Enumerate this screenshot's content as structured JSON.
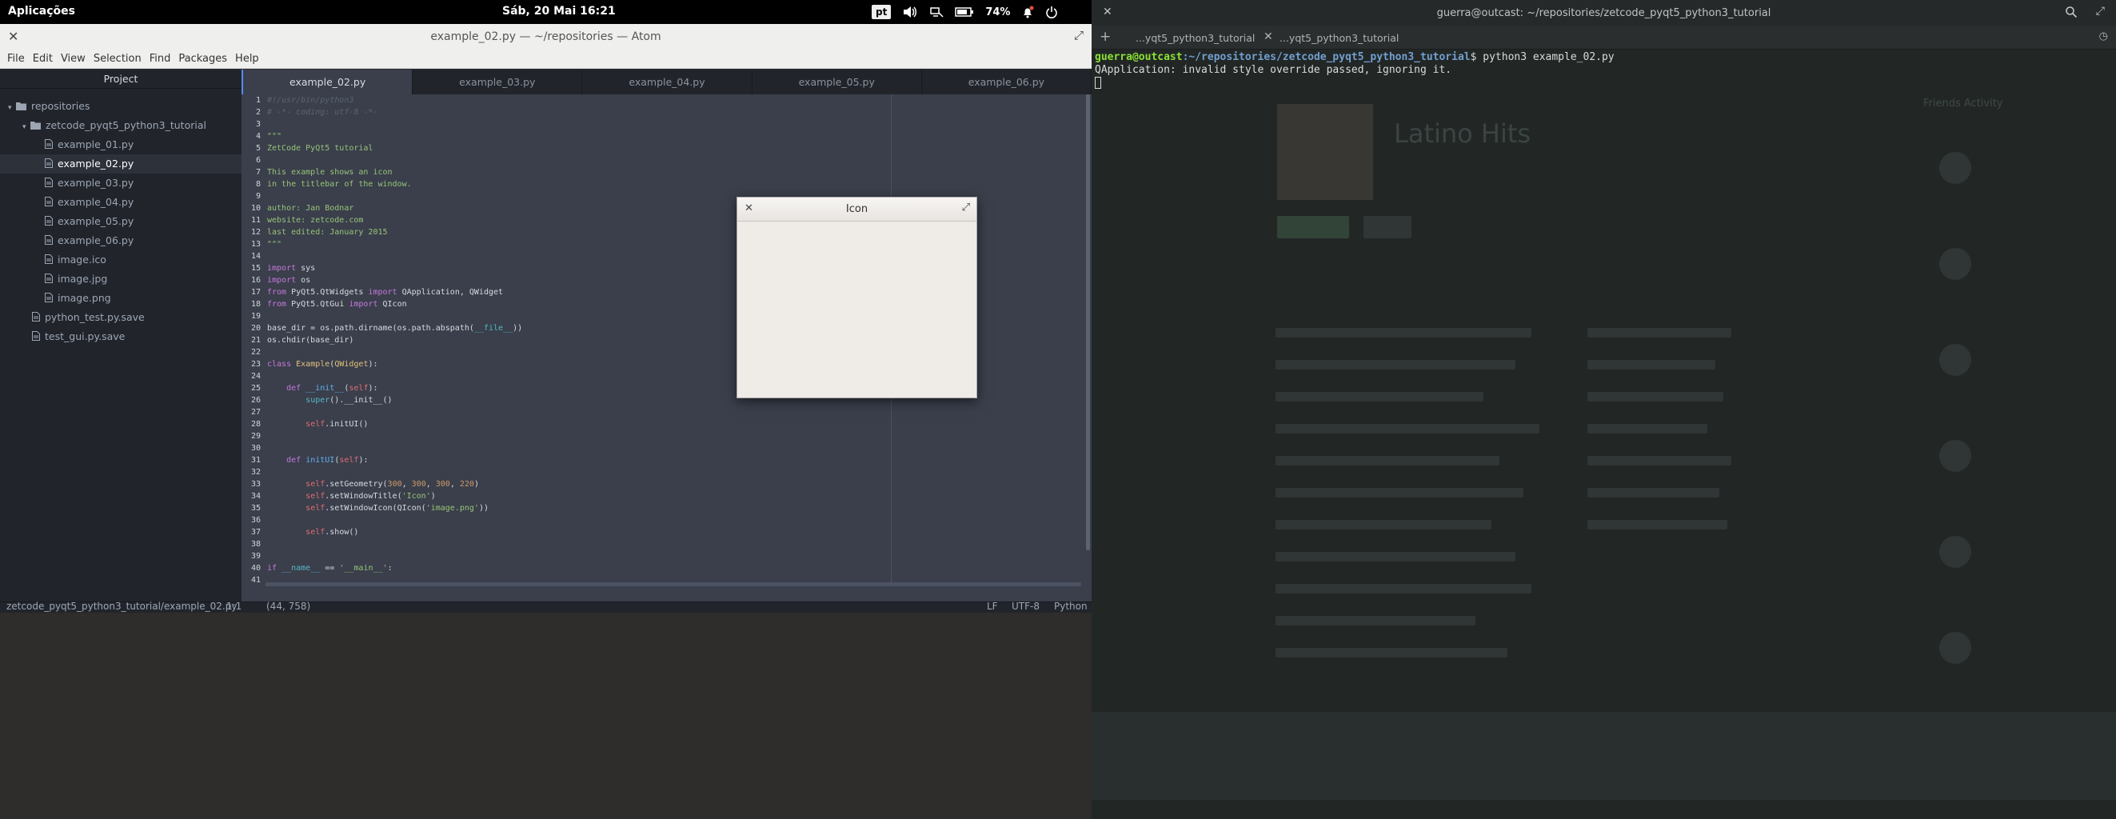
{
  "topbar": {
    "apps_label": "Aplicações",
    "clock": "Sáb, 20 Mai    16:21",
    "lang": "pt",
    "battery_pct": "74%"
  },
  "atom": {
    "title": "example_02.py — ~/repositories — Atom",
    "menu": [
      "File",
      "Edit",
      "View",
      "Selection",
      "Find",
      "Packages",
      "Help"
    ],
    "tree_header": "Project",
    "tree": [
      {
        "label": "repositories",
        "type": "folder",
        "depth": 0,
        "expanded": true,
        "selected": false
      },
      {
        "label": "zetcode_pyqt5_python3_tutorial",
        "type": "folder",
        "depth": 1,
        "expanded": true,
        "selected": false
      },
      {
        "label": "example_01.py",
        "type": "file",
        "depth": 2,
        "selected": false
      },
      {
        "label": "example_02.py",
        "type": "file",
        "depth": 2,
        "selected": true
      },
      {
        "label": "example_03.py",
        "type": "file",
        "depth": 2,
        "selected": false
      },
      {
        "label": "example_04.py",
        "type": "file",
        "depth": 2,
        "selected": false
      },
      {
        "label": "example_05.py",
        "type": "file",
        "depth": 2,
        "selected": false
      },
      {
        "label": "example_06.py",
        "type": "file",
        "depth": 2,
        "selected": false
      },
      {
        "label": "image.ico",
        "type": "file",
        "depth": 2,
        "selected": false
      },
      {
        "label": "image.jpg",
        "type": "file",
        "depth": 2,
        "selected": false
      },
      {
        "label": "image.png",
        "type": "file",
        "depth": 2,
        "selected": false
      },
      {
        "label": "python_test.py.save",
        "type": "file",
        "depth": 1,
        "selected": false
      },
      {
        "label": "test_gui.py.save",
        "type": "file",
        "depth": 1,
        "selected": false
      }
    ],
    "tabs": [
      {
        "label": "example_02.py",
        "active": true
      },
      {
        "label": "example_03.py",
        "active": false
      },
      {
        "label": "example_04.py",
        "active": false
      },
      {
        "label": "example_05.py",
        "active": false
      },
      {
        "label": "example_06.py",
        "active": false
      }
    ],
    "code_lines": [
      [
        [
          "cm",
          "#!/usr/bin/python3"
        ]
      ],
      [
        [
          "cm",
          "# -*- coding: utf-8 -*-"
        ]
      ],
      [],
      [
        [
          "str",
          "\"\"\""
        ]
      ],
      [
        [
          "str",
          "ZetCode PyQt5 tutorial"
        ]
      ],
      [],
      [
        [
          "str",
          "This example shows an icon"
        ]
      ],
      [
        [
          "str",
          "in the titlebar of the window."
        ]
      ],
      [],
      [
        [
          "str",
          "author: Jan Bodnar"
        ]
      ],
      [
        [
          "str",
          "website: zetcode.com"
        ]
      ],
      [
        [
          "str",
          "last edited: January 2015"
        ]
      ],
      [
        [
          "str",
          "\"\"\""
        ]
      ],
      [],
      [
        [
          "kw",
          "import"
        ],
        [
          "id",
          " sys"
        ]
      ],
      [
        [
          "kw",
          "import"
        ],
        [
          "id",
          " os"
        ]
      ],
      [
        [
          "kw",
          "from"
        ],
        [
          "id",
          " PyQt5.QtWidgets "
        ],
        [
          "kw",
          "import"
        ],
        [
          "id",
          " QApplication, QWidget"
        ]
      ],
      [
        [
          "kw",
          "from"
        ],
        [
          "id",
          " PyQt5.QtGui "
        ],
        [
          "kw",
          "import"
        ],
        [
          "id",
          " QIcon"
        ]
      ],
      [],
      [
        [
          "id",
          "base_dir = os.path.dirname(os.path.abspath("
        ],
        [
          "mag",
          "__file__"
        ],
        [
          "id",
          "))"
        ]
      ],
      [
        [
          "id",
          "os.chdir(base_dir)"
        ]
      ],
      [],
      [
        [
          "kw",
          "class"
        ],
        [
          "id",
          " "
        ],
        [
          "cls",
          "Example"
        ],
        [
          "id",
          "("
        ],
        [
          "cls",
          "QWidget"
        ],
        [
          "id",
          "):"
        ]
      ],
      [],
      [
        [
          "id",
          "    "
        ],
        [
          "kw",
          "def"
        ],
        [
          "id",
          " "
        ],
        [
          "fn",
          "__init__"
        ],
        [
          "id",
          "("
        ],
        [
          "self",
          "self"
        ],
        [
          "id",
          "):"
        ]
      ],
      [
        [
          "id",
          "        "
        ],
        [
          "mag",
          "super"
        ],
        [
          "id",
          "().__init__()"
        ]
      ],
      [],
      [
        [
          "id",
          "        "
        ],
        [
          "self",
          "self"
        ],
        [
          "id",
          ".initUI()"
        ]
      ],
      [],
      [],
      [
        [
          "id",
          "    "
        ],
        [
          "kw",
          "def"
        ],
        [
          "id",
          " "
        ],
        [
          "fn",
          "initUI"
        ],
        [
          "id",
          "("
        ],
        [
          "self",
          "self"
        ],
        [
          "id",
          "):"
        ]
      ],
      [],
      [
        [
          "id",
          "        "
        ],
        [
          "self",
          "self"
        ],
        [
          "id",
          ".setGeometry("
        ],
        [
          "num",
          "300"
        ],
        [
          "id",
          ", "
        ],
        [
          "num",
          "300"
        ],
        [
          "id",
          ", "
        ],
        [
          "num",
          "300"
        ],
        [
          "id",
          ", "
        ],
        [
          "num",
          "220"
        ],
        [
          "id",
          ")"
        ]
      ],
      [
        [
          "id",
          "        "
        ],
        [
          "self",
          "self"
        ],
        [
          "id",
          ".setWindowTitle("
        ],
        [
          "str",
          "'Icon'"
        ],
        [
          "id",
          ")"
        ]
      ],
      [
        [
          "id",
          "        "
        ],
        [
          "self",
          "self"
        ],
        [
          "id",
          ".setWindowIcon(QIcon("
        ],
        [
          "str",
          "'image.png'"
        ],
        [
          "id",
          "))"
        ]
      ],
      [],
      [
        [
          "id",
          "        "
        ],
        [
          "self",
          "self"
        ],
        [
          "id",
          ".show()"
        ]
      ],
      [],
      [],
      [
        [
          "kw",
          "if"
        ],
        [
          "id",
          " "
        ],
        [
          "mag",
          "__name__"
        ],
        [
          "id",
          " == "
        ],
        [
          "str",
          "'__main__'"
        ],
        [
          "id",
          ":"
        ]
      ],
      [],
      [
        [
          "id",
          "    app = QApplication(sys.argv)"
        ]
      ]
    ],
    "status": {
      "path": "zetcode_pyqt5_python3_tutorial/example_02.py",
      "cursor": "1:1",
      "mouse": "(44, 758)",
      "eol": "LF",
      "encoding": "UTF-8",
      "grammar": "Python"
    }
  },
  "qt_window": {
    "title": "Icon"
  },
  "terminal": {
    "title": "guerra@outcast: ~/repositories/zetcode_pyqt5_python3_tutorial",
    "tabs": [
      "...yqt5_python3_tutorial",
      "...yqt5_python3_tutorial"
    ],
    "prompt_user": "guerra@outcast",
    "prompt_path": ":~/repositories/zetcode_pyqt5_python3_tutorial",
    "command": "$ python3 example_02.py",
    "output": "QApplication: invalid style override passed, ignoring it."
  },
  "background_app": {
    "heading": "Latino Hits",
    "friends": "Friends Activity"
  }
}
